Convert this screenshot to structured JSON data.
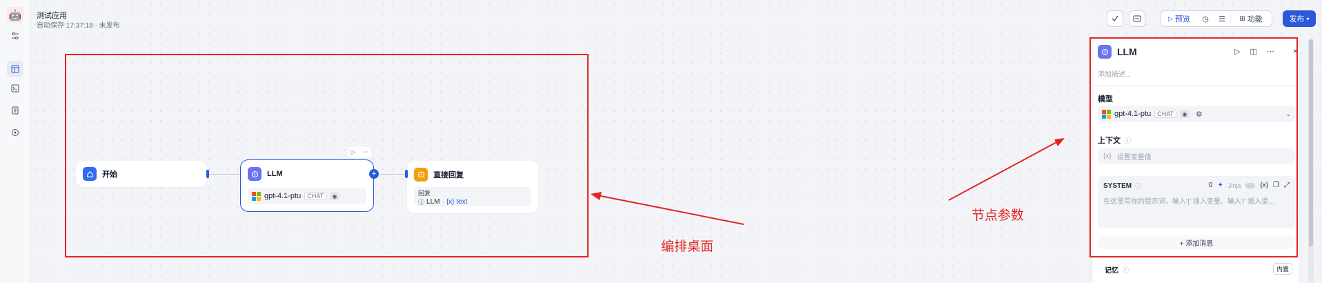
{
  "app": {
    "title": "测试应用",
    "autosave": "自动保存 17:37:18 · 未发布"
  },
  "sidebar": {
    "logo_icon": "robot-avatar",
    "icons": [
      "settings-sliders-icon",
      "orchestrate-icon",
      "terminal-icon",
      "logs-icon",
      "monitor-icon"
    ]
  },
  "toolbar": {
    "preview_label": "预览",
    "features_label": "功能",
    "publish_label": "发布"
  },
  "nodes": {
    "start": {
      "title": "开始"
    },
    "llm": {
      "title": "LLM",
      "model": "gpt-4.1-ptu",
      "model_tag": "CHAT"
    },
    "answer": {
      "title": "直接回复",
      "field_label": "回复",
      "ref_node": "LLM",
      "ref_sep": "·",
      "ref_var": "{x} text"
    }
  },
  "annotations": {
    "canvas_label": "编排桌面",
    "panel_label": "节点参数"
  },
  "panel": {
    "title": "LLM",
    "description_placeholder": "添加描述...",
    "model_label": "模型",
    "model_name": "gpt-4.1-ptu",
    "model_tag": "CHAT",
    "context_label": "上下文",
    "context_placeholder": "设置变量值",
    "system_label": "SYSTEM",
    "system_count": "0",
    "system_jinja": "Jinja",
    "system_placeholder": "在这里写你的提示词，输入'{' 插入变量、输入'/' 插入提...",
    "add_message_label": "+ 添加消息",
    "memory_label": "记忆",
    "memory_value": "内置"
  },
  "colors": {
    "accent": "#2b59d9",
    "annotation_red": "#e52424",
    "start_icon_bg": "#2f6bf0",
    "llm_icon_bg": "#6b74f0",
    "answer_icon_bg": "#f59e0b"
  }
}
